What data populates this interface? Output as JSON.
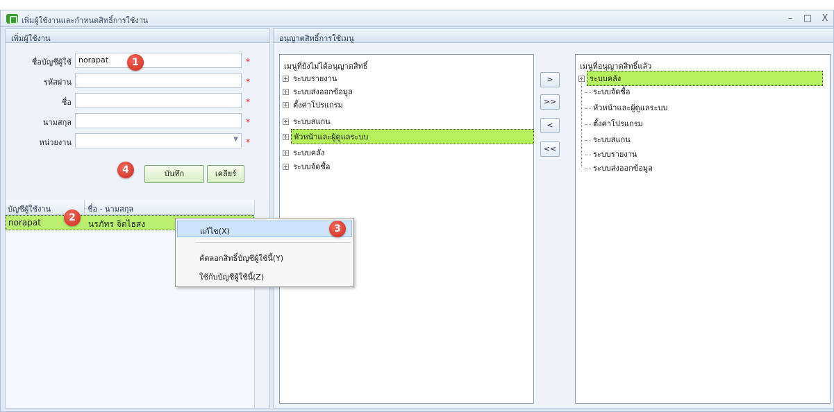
{
  "window": {
    "title": "เพิ่มผู้ใช้งานและกำหนดสิทธิ์การใช้งาน",
    "minimize": "–",
    "maximize": "□",
    "close": "X"
  },
  "left_panel": {
    "header": "เพิ่มผู้ใช้งาน",
    "fields": {
      "account_label": "ชื่อบัญชีผู้ใช้",
      "account_value": "norapat",
      "password_label": "รหัสผ่าน",
      "password_value": "",
      "first_name_label": "ชื่อ",
      "first_name_value": "",
      "last_name_label": "นามสกุล",
      "last_name_value": "",
      "department_label": "หน่วยงาน",
      "department_value": ""
    },
    "required_mark": "*",
    "combo_arrow": "▼",
    "save_button": "บันทึก",
    "clear_button": "เคลียร์",
    "grid": {
      "columns": [
        "บัญชีผู้ใช้งาน",
        "ชื่อ - นามสกุล"
      ],
      "rows": [
        {
          "account": "norapat",
          "name": "นรภัทร จิตไธสง"
        }
      ]
    }
  },
  "mid_panel": {
    "header": "อนุญาตสิทธิ์การใช้เมนู",
    "available": {
      "title": "เมนูที่ยังไม่ได้อนุญาตสิทธิ์",
      "expand_glyph": "+",
      "items": [
        "ระบบรายงาน",
        "ระบบส่งออกข้อมูล",
        "ตั้งค่าโปรแกรม",
        "ระบบสแกน",
        "หัวหน้าและผู้ดูแลระบบ",
        "ระบบคลัง",
        "ระบบจัดซื้อ"
      ],
      "selected": "หัวหน้าและผู้ดูแลระบบ"
    },
    "move_buttons": [
      ">",
      ">>",
      "<",
      "<<"
    ],
    "granted": {
      "title": "เมนูที่อนุญาตสิทธิ์แล้ว",
      "root": "ระบบคลัง",
      "children": [
        "ระบบจัดซื้อ",
        "หัวหน้าและผู้ดูแลระบบ",
        "ตั้งค่าโปรแกรม",
        "ระบบสแกน",
        "ระบบรายงาน",
        "ระบบส่งออกข้อมูล"
      ]
    }
  },
  "context_menu": {
    "items": [
      "แก้ไข(X)",
      "คัดลอกสิทธิ์บัญชีผู้ใช้นี้(Y)",
      "ใช้กับบัญชีผู้ใช้นี้(Z)"
    ]
  },
  "annotations": {
    "badges": [
      "1",
      "2",
      "3",
      "4"
    ]
  }
}
